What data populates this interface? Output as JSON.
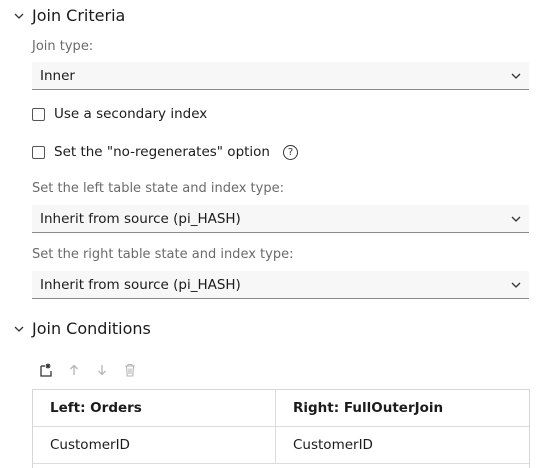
{
  "join_criteria": {
    "title": "Join Criteria",
    "join_type_label": "Join type:",
    "join_type_value": "Inner",
    "secondary_index_label": "Use a secondary index",
    "no_regenerates_label": "Set the \"no-regenerates\" option",
    "help_glyph": "?",
    "left_state_label": "Set the left table state and index type:",
    "left_state_value": "Inherit from source (pi_HASH)",
    "right_state_label": "Set the right table state and index type:",
    "right_state_value": "Inherit from source (pi_HASH)"
  },
  "join_conditions": {
    "title": "Join Conditions",
    "toolbar": {
      "add_icon": "add-row-icon",
      "up_icon": "arrow-up-icon",
      "down_icon": "arrow-down-icon",
      "delete_icon": "trash-icon"
    },
    "columns": [
      "Left: Orders",
      "Right: FullOuterJoin"
    ],
    "rows": [
      [
        "CustomerID",
        "CustomerID"
      ]
    ]
  },
  "colors": {
    "field_bg": "#f7f7f7",
    "field_border": "#8a8a8a",
    "label_text": "#6b6b6b",
    "disabled_icon": "#b5b5b5"
  }
}
